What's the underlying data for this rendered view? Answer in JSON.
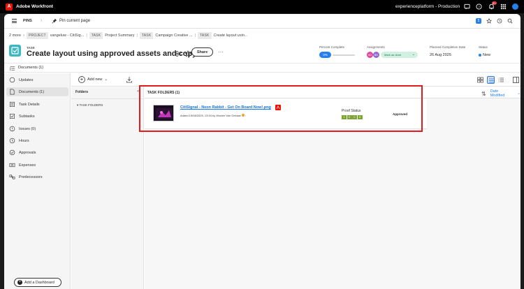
{
  "topbar": {
    "app_name": "Adobe Workfront",
    "org_label": "experienceplatform - Production",
    "notif_count": "9+"
  },
  "nav": {
    "pins_label": "PINS",
    "pin_current_label": "Pin current page",
    "badge_count": "5"
  },
  "breadcrumb": {
    "more": "2 more",
    "items": [
      {
        "type": "PROJECT",
        "name": "vangeluw - CitiSig..."
      },
      {
        "type": "TASK",
        "name": "Project Summary"
      },
      {
        "type": "TASK",
        "name": "Campaign Creative ..."
      },
      {
        "type": "TASK",
        "name": "Create layout usin..."
      }
    ]
  },
  "task": {
    "type_label": "TASK",
    "title": "Create layout using approved assets and copy",
    "share_label": "Share"
  },
  "meta": {
    "percent_complete_label": "Percent Complete",
    "percent_value": "0%",
    "percent_fraction": 0,
    "assignments_label": "Assignments",
    "assignees": [
      {
        "initials": "SG",
        "color": "#e0479a"
      },
      {
        "initials": "BG",
        "color": "#8f6ad1"
      }
    ],
    "mark_done_label": "Mark as done",
    "planned_label": "Planned Completion Date",
    "planned_value": "26 Aug 2025",
    "status_label": "Status",
    "status_value": "New"
  },
  "docs_row": {
    "label": "Documents (1)"
  },
  "sidebar": {
    "items": [
      {
        "label": "Updates",
        "icon": "chat-icon"
      },
      {
        "label": "Documents (1)",
        "icon": "document-icon",
        "active": true
      },
      {
        "label": "Task Details",
        "icon": "details-icon"
      },
      {
        "label": "Subtasks",
        "icon": "subtasks-icon"
      },
      {
        "label": "Issues (0)",
        "icon": "issues-icon"
      },
      {
        "label": "Hours",
        "icon": "clock-icon"
      },
      {
        "label": "Approvals",
        "icon": "approvals-icon"
      },
      {
        "label": "Expenses",
        "icon": "expenses-icon"
      },
      {
        "label": "Predecessors",
        "icon": "predecessors-icon"
      }
    ],
    "add_dashboard_label": "Add a Dashboard"
  },
  "toolbar": {
    "add_new_label": "Add new"
  },
  "folders": {
    "header": "Folders",
    "task_folders": "TASK FOLDERS"
  },
  "main": {
    "section_title": "TASK FOLDERS (1)",
    "sort_label": "Date Modified",
    "document": {
      "name": "CitiSignal - Neon Rabbit - Get On Board Now!.png",
      "meta": "Added 19/08/2025, 13:54 by Wouter Van Geluwe",
      "proof_status_label": "Proof Status",
      "proof_chips": [
        "1",
        "O",
        "C",
        "D"
      ],
      "approval_status": "Approved"
    }
  },
  "colors": {
    "accent": "#2680eb",
    "teal_task": "#3eb8bf",
    "highlight": "#e11b1b",
    "proof_green": "#7ea531"
  }
}
